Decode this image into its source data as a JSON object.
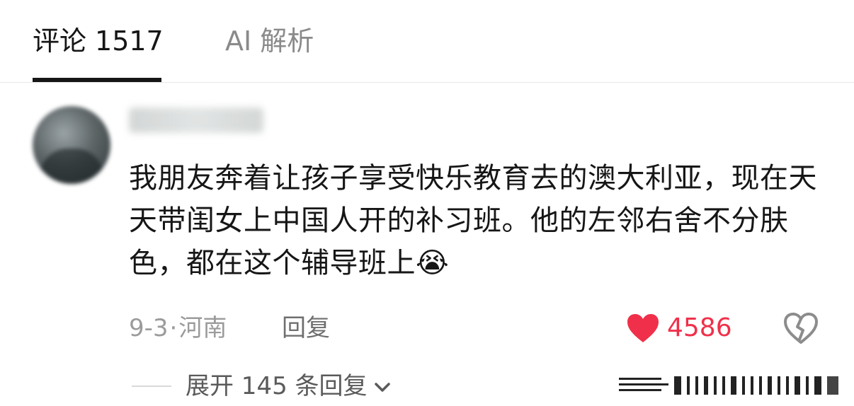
{
  "tabs": {
    "comments_label": "评论",
    "comments_count": "1517",
    "ai_label": "AI 解析"
  },
  "comment": {
    "text": "我朋友奔着让孩子享受快乐教育去的澳大利亚，现在天天带闺女上中国人开的补习班。他的左邻右舍不分肤色，都在这个辅导班上",
    "emoji": "😭",
    "date": "9-3",
    "separator": "·",
    "location": "河南",
    "reply_label": "回复",
    "like_count": "4586",
    "colors": {
      "like": "#f0304a",
      "meta": "#9b9b9b"
    }
  },
  "expand": {
    "label": "展开 145 条回复"
  },
  "icons": {
    "heart": "heart-icon",
    "broken_heart": "broken-heart-icon",
    "chevron": "chevron-down-icon"
  }
}
